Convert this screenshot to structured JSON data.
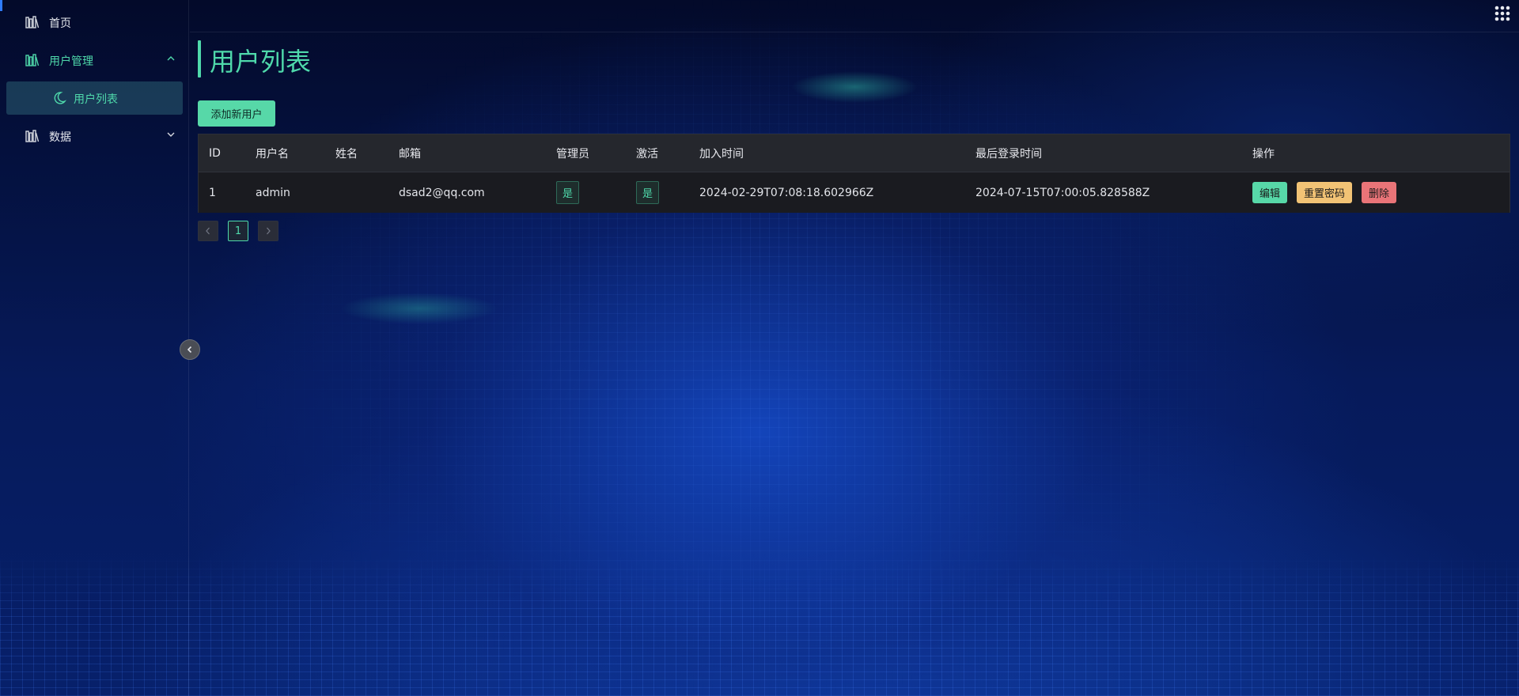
{
  "sidebar": {
    "items": [
      {
        "label": "首页",
        "icon": "library-icon"
      },
      {
        "label": "用户管理",
        "icon": "library-icon",
        "expanded": true,
        "children": [
          {
            "label": "用户列表",
            "icon": "moon-icon",
            "active": true
          }
        ]
      },
      {
        "label": "数据",
        "icon": "library-icon",
        "expanded": false
      }
    ]
  },
  "header": {
    "title": "用户列表"
  },
  "toolbar": {
    "add_label": "添加新用户"
  },
  "table": {
    "columns": [
      "ID",
      "用户名",
      "姓名",
      "邮箱",
      "管理员",
      "激活",
      "加入时间",
      "最后登录时间",
      "操作"
    ],
    "rows": [
      {
        "id": "1",
        "username": "admin",
        "name": "",
        "email": "dsad2@qq.com",
        "is_admin": "是",
        "is_active": "是",
        "joined": "2024-02-29T07:08:18.602966Z",
        "last_login": "2024-07-15T07:00:05.828588Z",
        "actions": {
          "edit": "编辑",
          "reset": "重置密码",
          "delete": "删除"
        }
      }
    ]
  },
  "pagination": {
    "current": "1"
  },
  "colors": {
    "accent": "#4fd9ab",
    "warning": "#f2c375",
    "danger": "#e97478"
  }
}
